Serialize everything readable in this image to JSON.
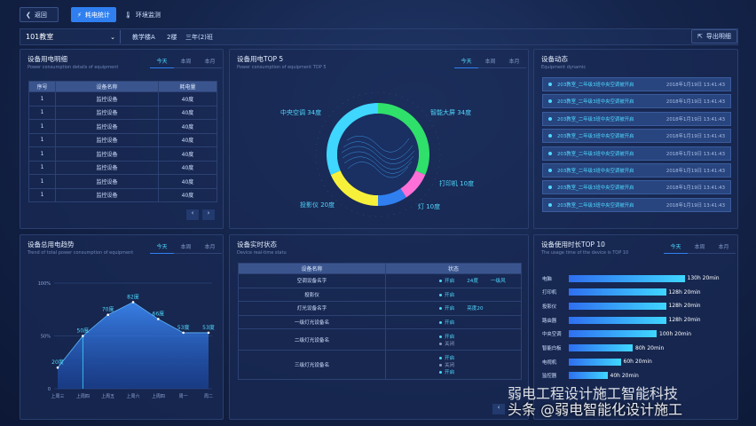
{
  "header": {
    "back": "返回",
    "tab_power": "耗电统计",
    "tab_env": "环境监测"
  },
  "filter": {
    "room": "101教室",
    "building": "教学楼A",
    "floor": "2楼",
    "cls": "三年(2)班",
    "export": "导出明细"
  },
  "tabs": {
    "today": "今天",
    "week": "本周",
    "month": "本月"
  },
  "detail": {
    "title": "设备用电明细",
    "sub": "Power consumption details of equipment",
    "cols": [
      "序号",
      "设备名称",
      "耗电量"
    ],
    "rows": [
      [
        "1",
        "监控设备",
        "40度"
      ],
      [
        "1",
        "监控设备",
        "40度"
      ],
      [
        "1",
        "监控设备",
        "40度"
      ],
      [
        "1",
        "监控设备",
        "40度"
      ],
      [
        "1",
        "监控设备",
        "40度"
      ],
      [
        "1",
        "监控设备",
        "40度"
      ],
      [
        "1",
        "监控设备",
        "40度"
      ],
      [
        "1",
        "监控设备",
        "40度"
      ]
    ]
  },
  "top5": {
    "title": "设备用电TOP 5",
    "sub": "Power consumption of equipment TOP 5",
    "labels": {
      "ac": "中央空调 34度",
      "screen": "智能大屏 34度",
      "printer": "打印机 10度",
      "lamp": "灯 10度",
      "projector": "投影仪 20度"
    }
  },
  "chart_data": {
    "type": "pie",
    "categories": [
      "中央空调",
      "智能大屏",
      "打印机",
      "灯",
      "投影仪"
    ],
    "values": [
      34,
      34,
      10,
      10,
      20
    ],
    "colors": [
      "#3fd6ff",
      "#2fe06a",
      "#ff6fd8",
      "#2f7ff0",
      "#f7f03a"
    ]
  },
  "dynamic": {
    "title": "设备动态",
    "sub": "Equipment dynamic",
    "items": [
      {
        "text": "203教室_二年级3班中央空调被开启",
        "time": "2018年1月19日 13:41:43"
      },
      {
        "text": "203教室_二年级3班中央空调被开启",
        "time": "2018年1月19日 13:41:43"
      },
      {
        "text": "203教室_二年级3班中央空调被开启",
        "time": "2018年1月19日 13:41:43"
      },
      {
        "text": "203教室_二年级3班中央空调被开启",
        "time": "2018年1月19日 13:41:43"
      },
      {
        "text": "203教室_二年级3班中央空调被开启",
        "time": "2018年1月19日 13:41:43"
      },
      {
        "text": "203教室_二年级3班中央空调被开启",
        "time": "2018年1月19日 13:41:43"
      },
      {
        "text": "203教室_二年级3班中央空调被开启",
        "time": "2018年1月19日 13:41:43"
      },
      {
        "text": "203教室_二年级3班中央空调被开启",
        "time": "2018年1月19日 13:41:43"
      }
    ]
  },
  "trend": {
    "title": "设备总用电趋势",
    "sub": "Trend of total power consumption of equipment",
    "yticks": [
      "100%",
      "50%",
      "0"
    ],
    "x": [
      "上周三",
      "上周四",
      "上周五",
      "上周六",
      "上周四",
      "周一",
      "周二"
    ],
    "values": [
      20,
      50,
      70,
      82,
      66,
      53,
      53
    ],
    "labels": [
      "20度",
      "50度",
      "70度",
      "82度",
      "66度",
      "53度",
      "53度"
    ]
  },
  "status": {
    "title": "设备实时状态",
    "sub": "Device real-time statu",
    "cols": [
      "设备名称",
      "状态"
    ],
    "rows": [
      {
        "name": "空调设备名字",
        "lines": [
          {
            "s": "on",
            "t": "开启",
            "extra": "24度",
            "extra2": "一级风"
          }
        ]
      },
      {
        "name": "投影仪",
        "lines": [
          {
            "s": "on",
            "t": "开启"
          }
        ]
      },
      {
        "name": "灯光设备名字",
        "lines": [
          {
            "s": "on",
            "t": "开启",
            "extra": "亮度20"
          }
        ]
      },
      {
        "name": "一级灯光设备名",
        "lines": [
          {
            "s": "on",
            "t": "开启"
          }
        ]
      },
      {
        "name": "二级灯光设备名",
        "lines": [
          {
            "s": "on",
            "t": "开启"
          },
          {
            "s": "off",
            "t": "关闭"
          }
        ]
      },
      {
        "name": "三级灯光设备名",
        "lines": [
          {
            "s": "on",
            "t": "开启"
          },
          {
            "s": "off",
            "t": "关闭"
          },
          {
            "s": "on",
            "t": "开启"
          }
        ]
      }
    ]
  },
  "usage": {
    "title": "设备使用时长TOP 10",
    "sub": "The usage time of the device is TOP 10",
    "items": [
      {
        "name": "电脑",
        "value": "130h 20min",
        "pct": 0.87
      },
      {
        "name": "打印机",
        "value": "128h 20min",
        "pct": 0.73
      },
      {
        "name": "投影仪",
        "value": "128h 20min",
        "pct": 0.73
      },
      {
        "name": "路由器",
        "value": "128h 20min",
        "pct": 0.73
      },
      {
        "name": "中央空调",
        "value": "100h 20min",
        "pct": 0.66
      },
      {
        "name": "智能白板",
        "value": "80h 20min",
        "pct": 0.48
      },
      {
        "name": "电视机",
        "value": "60h 20min",
        "pct": 0.39
      },
      {
        "name": "监控器",
        "value": "40h 20min",
        "pct": 0.29
      }
    ]
  },
  "watermark": "头条 @弱电智能化设计施工",
  "watermark2": "弱电工程设计施工智能科技"
}
